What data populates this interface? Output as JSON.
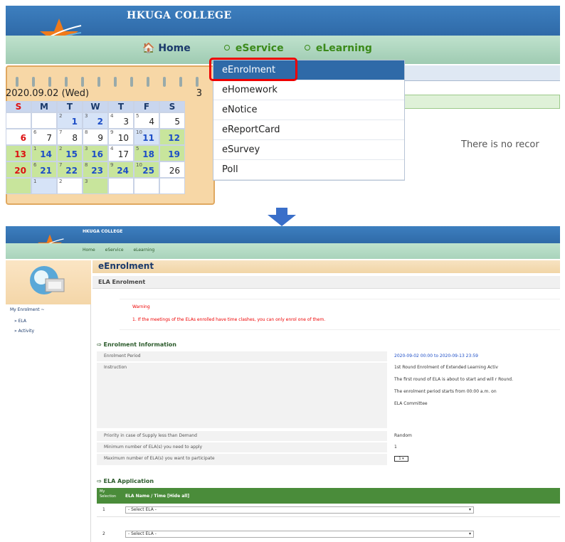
{
  "top": {
    "site_title": "HKUGA COLLEGE",
    "nav": {
      "home": "Home",
      "eservice": "eService",
      "elearning": "eLearning"
    },
    "calendar": {
      "date_label": "2020.09.02 (Wed)",
      "week_number": "3",
      "days": [
        "S",
        "M",
        "T",
        "W",
        "T",
        "F",
        "S"
      ],
      "weeks": [
        [
          {
            "n": ""
          },
          {
            "n": ""
          },
          {
            "n": "1",
            "s": "2",
            "c": "blue",
            "bg": "blue"
          },
          {
            "n": "2",
            "s": "3",
            "c": "blue",
            "bg": "blue"
          },
          {
            "n": "3",
            "s": "4"
          },
          {
            "n": "4",
            "s": "5"
          },
          {
            "n": "5"
          }
        ],
        [
          {
            "n": "6",
            "c": "red"
          },
          {
            "n": "7",
            "s": "6"
          },
          {
            "n": "8",
            "s": "7"
          },
          {
            "n": "9",
            "s": "8"
          },
          {
            "n": "10",
            "s": "9"
          },
          {
            "n": "11",
            "s": "10",
            "c": "blue",
            "bg": "blue"
          },
          {
            "n": "12",
            "c": "blue",
            "bg": "green"
          }
        ],
        [
          {
            "n": "13",
            "c": "red",
            "bg": "green"
          },
          {
            "n": "14",
            "s": "1",
            "c": "blue",
            "bg": "green"
          },
          {
            "n": "15",
            "s": "2",
            "c": "blue",
            "bg": "green"
          },
          {
            "n": "16",
            "s": "3",
            "c": "blue",
            "bg": "green"
          },
          {
            "n": "17",
            "s": "4"
          },
          {
            "n": "18",
            "s": "5",
            "c": "blue",
            "bg": "green"
          },
          {
            "n": "19",
            "c": "blue",
            "bg": "green"
          }
        ],
        [
          {
            "n": "20",
            "c": "red",
            "bg": "green"
          },
          {
            "n": "21",
            "s": "6",
            "c": "blue",
            "bg": "green"
          },
          {
            "n": "22",
            "s": "7",
            "c": "blue",
            "bg": "green"
          },
          {
            "n": "23",
            "s": "8",
            "c": "blue",
            "bg": "green"
          },
          {
            "n": "24",
            "s": "9",
            "c": "blue",
            "bg": "green"
          },
          {
            "n": "25",
            "s": "10",
            "c": "blue",
            "bg": "green"
          },
          {
            "n": "26"
          }
        ],
        [
          {
            "n": "",
            "bg": "green"
          },
          {
            "n": "",
            "s": "1",
            "bg": "blue"
          },
          {
            "n": "",
            "s": "2"
          },
          {
            "n": "",
            "s": "3",
            "bg": "green"
          },
          {
            "n": ""
          },
          {
            "n": ""
          },
          {
            "n": ""
          }
        ]
      ]
    },
    "menu": [
      "eEnrolment",
      "eHomework",
      "eNotice",
      "eReportCard",
      "eSurvey",
      "Poll"
    ],
    "no_record": "There is no recor"
  },
  "bottom": {
    "site_title": "HKUGA COLLEGE",
    "nav": [
      "Home",
      "eService",
      "eLearning"
    ],
    "sidebar": {
      "my_enrolment": "My Enrolment ~",
      "ela": "» ELA",
      "activity": "» Activity"
    },
    "page_title": "eEnrolment",
    "sub_title": "ELA Enrolment",
    "warning_title": "Warning",
    "warning_text": "1.   If the meetings of the ELAs enrolled have time clashes, you can only enrol one of them.",
    "info_title": "Enrolment Information",
    "rows": {
      "period_label": "Enrolment Period",
      "period_value": "2020-09-02 00:00 to 2020-09-13 23:59",
      "instruction_label": "Instruction",
      "instruction_lines": [
        "1st Round Enrolment of Extended Learning Activ",
        "The first round of ELA is about to start and will r Round.",
        "The enrolment period starts from 00:00 a.m. on",
        "ELA Committee"
      ],
      "priority_label": "Priority in case of Supply less than Demand",
      "priority_value": "Random",
      "min_label": "Minimum number of ELA(s) you need to apply",
      "min_value": "1",
      "max_label": "Maximum number of ELA(s) you want to participate",
      "max_value": "1"
    },
    "application_title": "ELA Application",
    "app_head_col1": "My Selection",
    "app_head_col2": "ELA Name / Time [Hide all]",
    "app_rows": [
      {
        "n": "1",
        "select": "- Select ELA -"
      },
      {
        "n": "2",
        "select": "- Select ELA -"
      }
    ]
  },
  "colors": {
    "banner_blue": "#2f6aa8",
    "nav_green": "#bfe2cd",
    "highlight_red": "#e00000",
    "arrow_blue": "#3a6fc9"
  },
  "icons": [
    "star-logo-icon",
    "home-icon",
    "radio-icon",
    "down-arrow-icon",
    "monitor-icon",
    "section-arrow-icon"
  ]
}
